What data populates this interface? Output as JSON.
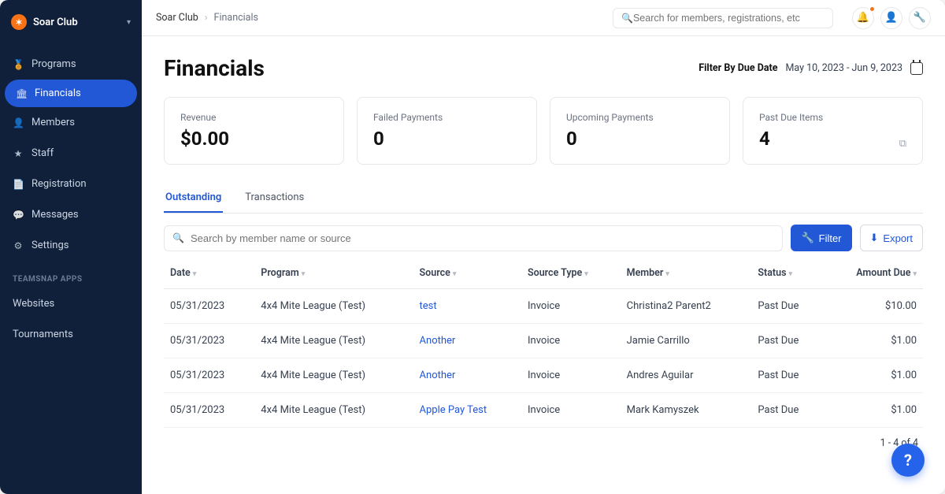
{
  "org_name": "Soar Club",
  "breadcrumb": {
    "root": "Soar Club",
    "current": "Financials"
  },
  "global_search_placeholder": "Search for members, registrations, etc",
  "sidebar": {
    "items": [
      {
        "icon": "medal-icon",
        "glyph": "🏅",
        "label": "Programs"
      },
      {
        "icon": "bank-icon",
        "glyph": "🏛",
        "label": "Financials"
      },
      {
        "icon": "person-icon",
        "glyph": "👤",
        "label": "Members"
      },
      {
        "icon": "star-icon",
        "glyph": "★",
        "label": "Staff"
      },
      {
        "icon": "doc-icon",
        "glyph": "📄",
        "label": "Registration"
      },
      {
        "icon": "chat-icon",
        "glyph": "💬",
        "label": "Messages"
      },
      {
        "icon": "gear-icon",
        "glyph": "⚙",
        "label": "Settings"
      }
    ],
    "active_index": 1,
    "section_title": "TEAMSNAP APPS",
    "apps": [
      {
        "label": "Websites"
      },
      {
        "label": "Tournaments"
      }
    ]
  },
  "page": {
    "title": "Financials",
    "filter_label": "Filter By Due Date",
    "filter_range": "May 10, 2023 - Jun 9, 2023"
  },
  "stats": {
    "revenue_label": "Revenue",
    "revenue_value": "$0.00",
    "failed_label": "Failed Payments",
    "failed_value": "0",
    "upcoming_label": "Upcoming Payments",
    "upcoming_value": "0",
    "pastdue_label": "Past Due Items",
    "pastdue_value": "4"
  },
  "tabs": {
    "outstanding": "Outstanding",
    "transactions": "Transactions",
    "active_index": 0
  },
  "toolbar": {
    "search_placeholder": "Search by member name or source",
    "filter_label": "Filter",
    "export_label": "Export"
  },
  "table": {
    "headers": {
      "date": "Date",
      "program": "Program",
      "source": "Source",
      "source_type": "Source Type",
      "member": "Member",
      "status": "Status",
      "amount_due": "Amount Due"
    },
    "rows": [
      {
        "date": "05/31/2023",
        "program": "4x4 Mite League (Test)",
        "source": "test",
        "source_type": "Invoice",
        "member": "Christina2 Parent2",
        "status": "Past Due",
        "amount": "$10.00"
      },
      {
        "date": "05/31/2023",
        "program": "4x4 Mite League (Test)",
        "source": "Another",
        "source_type": "Invoice",
        "member": "Jamie Carrillo",
        "status": "Past Due",
        "amount": "$1.00"
      },
      {
        "date": "05/31/2023",
        "program": "4x4 Mite League (Test)",
        "source": "Another",
        "source_type": "Invoice",
        "member": "Andres Aguilar",
        "status": "Past Due",
        "amount": "$1.00"
      },
      {
        "date": "05/31/2023",
        "program": "4x4 Mite League (Test)",
        "source": "Apple Pay Test",
        "source_type": "Invoice",
        "member": "Mark Kamyszek",
        "status": "Past Due",
        "amount": "$1.00"
      }
    ]
  },
  "pagination_text": "1 - 4 of 4",
  "help_label": "?"
}
